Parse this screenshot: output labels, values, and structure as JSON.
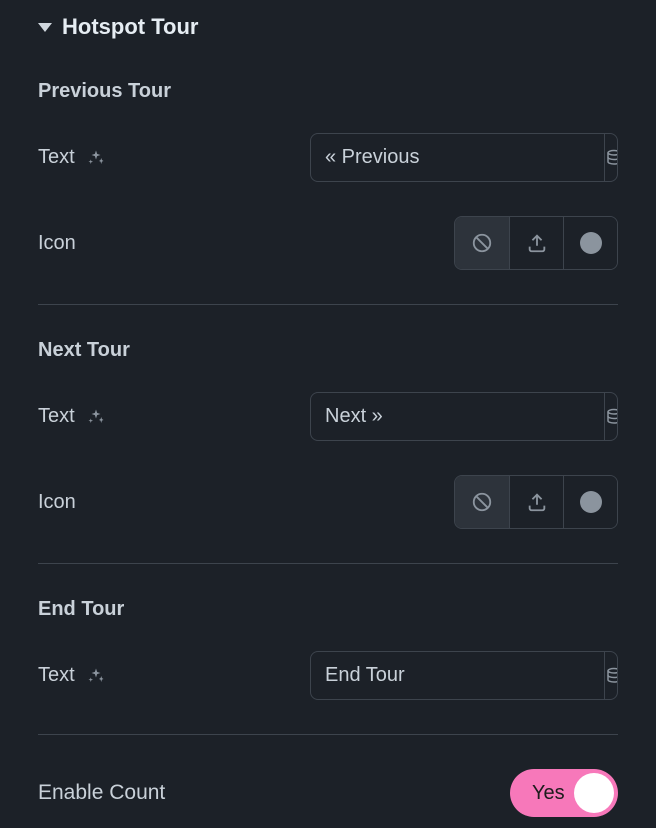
{
  "section": {
    "title": "Hotspot Tour"
  },
  "previous": {
    "heading": "Previous Tour",
    "textLabel": "Text",
    "textValue": "« Previous",
    "iconLabel": "Icon"
  },
  "next": {
    "heading": "Next Tour",
    "textLabel": "Text",
    "textValue": "Next »",
    "iconLabel": "Icon"
  },
  "end": {
    "heading": "End Tour",
    "textLabel": "Text",
    "textValue": "End Tour"
  },
  "enableCount": {
    "label": "Enable Count",
    "stateText": "Yes",
    "state": true
  }
}
